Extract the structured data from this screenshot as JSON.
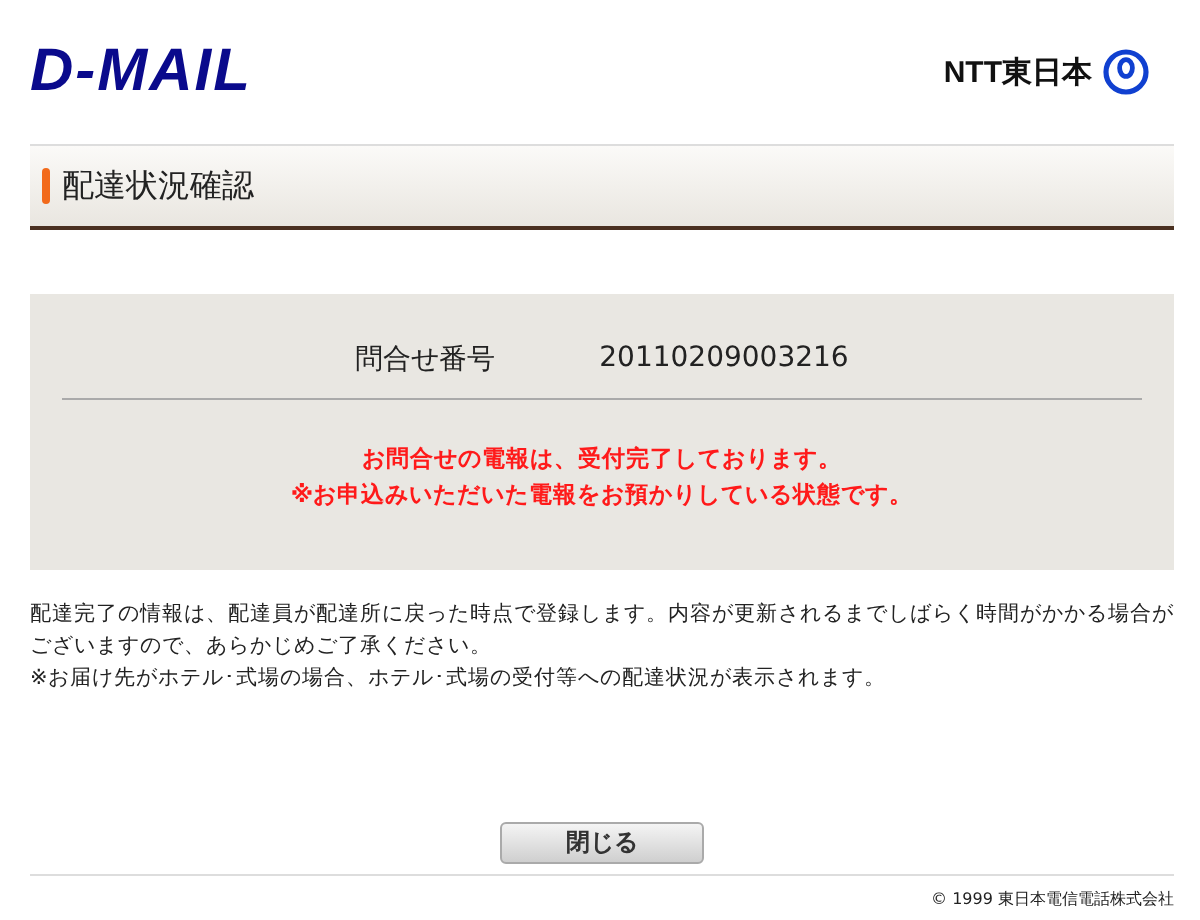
{
  "header": {
    "logo": "D-MAIL",
    "company": "NTT東日本"
  },
  "page_title": "配達状況確認",
  "inquiry": {
    "label": "問合せ番号",
    "number": "20110209003216"
  },
  "status_messages": [
    "お問合せの電報は、受付完了しております。",
    "※お申込みいただいた電報をお預かりしている状態です。"
  ],
  "notes": [
    "配達完了の情報は、配達員が配達所に戻った時点で登録します。内容が更新されるまでしばらく時間がかかる場合がございますので、あらかじめご了承ください。",
    "※お届け先がホテル･式場の場合、ホテル･式場の受付等への配達状況が表示されます。"
  ],
  "buttons": [
    "閉じる"
  ],
  "footer": {
    "copyright": "© 1999 東日本電信電話株式会社"
  }
}
